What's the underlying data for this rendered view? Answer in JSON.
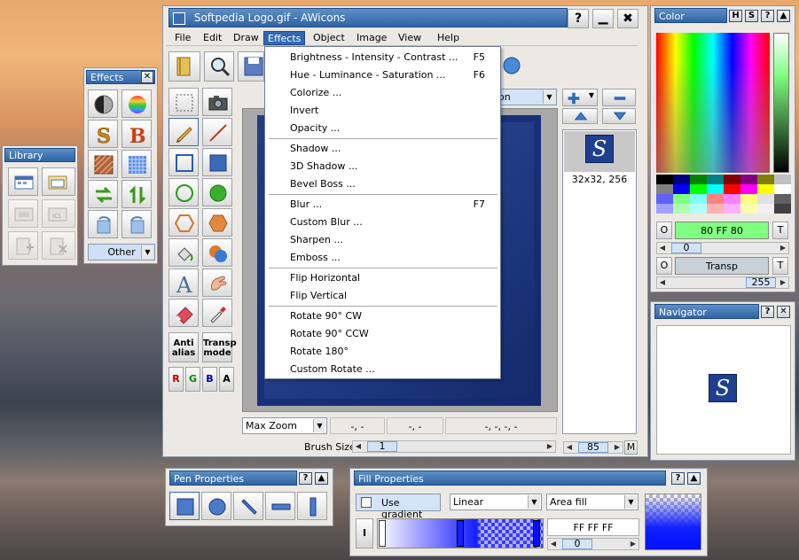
{
  "main_window": {
    "title": "Softpedia Logo.gif - AWicons",
    "menu": [
      "File",
      "Edit",
      "Draw",
      "Effects",
      "Object",
      "Image",
      "View",
      "Help"
    ],
    "active_menu": "Effects"
  },
  "effects_menu": {
    "items": [
      {
        "label": "Brightness - Intensity - Contrast ...",
        "shortcut": "F5"
      },
      {
        "label": "Hue - Luminance - Saturation ...",
        "shortcut": "F6"
      },
      {
        "label": "Colorize ...",
        "shortcut": ""
      },
      {
        "label": "Invert",
        "shortcut": ""
      },
      {
        "label": "Opacity ...",
        "shortcut": ""
      },
      {
        "label": "Shadow ...",
        "shortcut": ""
      },
      {
        "label": "3D Shadow ...",
        "shortcut": ""
      },
      {
        "label": "Bevel Boss ...",
        "shortcut": ""
      },
      {
        "label": "Blur ...",
        "shortcut": "F7"
      },
      {
        "label": "Custom Blur ...",
        "shortcut": ""
      },
      {
        "label": "Sharpen ...",
        "shortcut": ""
      },
      {
        "label": "Emboss ...",
        "shortcut": ""
      },
      {
        "label": "Flip Horizontal",
        "shortcut": ""
      },
      {
        "label": "Flip Vertical",
        "shortcut": ""
      },
      {
        "label": "Rotate 90° CW",
        "shortcut": ""
      },
      {
        "label": "Rotate 90° CCW",
        "shortcut": ""
      },
      {
        "label": "Rotate 180°",
        "shortcut": ""
      },
      {
        "label": "Custom Rotate ...",
        "shortcut": ""
      }
    ]
  },
  "toolbox": {
    "antialias_label": "Anti alias",
    "transp_label": "Transp mode",
    "channels": [
      "R",
      "G",
      "B",
      "A"
    ]
  },
  "canvas": {
    "zoom_label": "Max Zoom",
    "coord1": "-, -",
    "coord2": "-, -",
    "coord3": "-, -, -, -",
    "brush_size_label": "Brush Size",
    "brush_size_value": "1",
    "format_combo_partial": "on"
  },
  "icon_list": {
    "format_label": "32x32, 256",
    "scroll_value": "85",
    "m_label": "M",
    "thumbnail_letter": "S"
  },
  "effects_panel": {
    "title": "Effects",
    "other_label": "Other"
  },
  "library_panel": {
    "title": "Library"
  },
  "color_panel": {
    "title": "Color",
    "fore_label": "O",
    "fore_value": "80 FF 80",
    "fore_t": "T",
    "fore_scroll": "0",
    "back_label": "O",
    "back_value": "Transp",
    "back_t": "T",
    "back_scroll": "255",
    "fore_color": "#80ff80"
  },
  "navigator_panel": {
    "title": "Navigator",
    "thumbnail_letter": "S"
  },
  "pen_panel": {
    "title": "Pen Properties"
  },
  "fill_panel": {
    "title": "Fill Properties",
    "use_gradient_label": "Use gradient",
    "gradient_type": "Linear",
    "fill_mode": "Area fill",
    "color_hex": "FF FF FF",
    "color_scroll": "0",
    "i_label": "I"
  }
}
